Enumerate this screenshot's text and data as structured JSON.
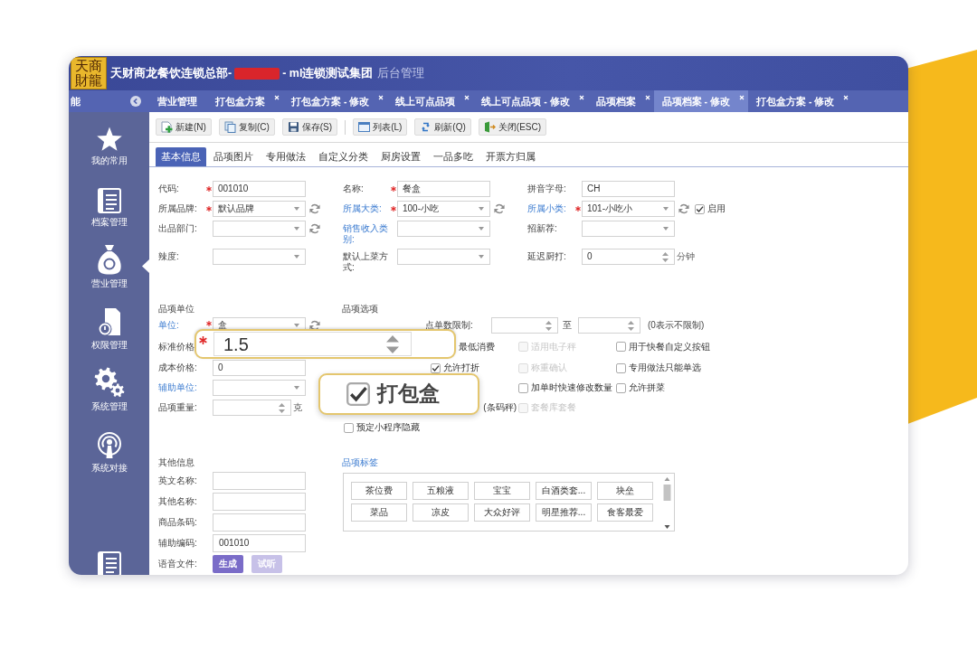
{
  "header": {
    "logo": "天商財龍",
    "title_parts": [
      {
        "kind": "text",
        "text": "天财商龙餐饮连锁总部-"
      },
      {
        "kind": "redacted"
      },
      {
        "kind": "text",
        "text": "- ml连锁测试集团"
      },
      {
        "kind": "muted",
        "text": "后台管理"
      }
    ]
  },
  "tab_bar": {
    "menu_label": "能",
    "tabs": [
      {
        "label": "营业管理",
        "closable": false,
        "selected": false
      },
      {
        "label": "打包盒方案",
        "closable": true,
        "selected": false
      },
      {
        "label": "打包盒方案 - 修改",
        "closable": true,
        "selected": false
      },
      {
        "label": "线上可点品项",
        "closable": true,
        "selected": false
      },
      {
        "label": "线上可点品项 - 修改",
        "closable": true,
        "selected": false
      },
      {
        "label": "品项档案",
        "closable": true,
        "selected": false
      },
      {
        "label": "品项档案 - 修改",
        "closable": true,
        "selected": true
      },
      {
        "label": "打包盒方案 - 修改",
        "closable": true,
        "selected": false
      }
    ]
  },
  "sidebar": {
    "items": [
      {
        "kind": "star",
        "label": "我的常用",
        "selected": false
      },
      {
        "kind": "archive",
        "label": "档案管理",
        "selected": false
      },
      {
        "kind": "bag",
        "label": "营业管理",
        "selected": true
      },
      {
        "kind": "document",
        "label": "权限管理",
        "selected": false
      },
      {
        "kind": "gears",
        "label": "系统管理",
        "selected": false
      },
      {
        "kind": "broadcast",
        "label": "系统对接",
        "selected": false
      },
      {
        "kind": "archive",
        "selected": false
      }
    ]
  },
  "toolbar": {
    "buttons": [
      {
        "kind": "new",
        "label": "新建(N)",
        "separator_before": false
      },
      {
        "kind": "copy",
        "label": "复制(C)",
        "separator_before": false
      },
      {
        "kind": "save",
        "label": "保存(S)",
        "separator_before": false
      },
      {
        "kind": "list",
        "label": "列表(L)",
        "separator_before": true
      },
      {
        "kind": "refresh",
        "label": "刷新(Q)",
        "separator_before": false
      },
      {
        "kind": "close",
        "label": "关闭(ESC)",
        "separator_before": false
      }
    ]
  },
  "form_tabs": [
    {
      "label": "基本信息",
      "selected": true
    },
    {
      "label": "品项图片",
      "selected": false
    },
    {
      "label": "专用做法",
      "selected": false
    },
    {
      "label": "自定义分类",
      "selected": false
    },
    {
      "label": "厨房设置",
      "selected": false
    },
    {
      "label": "一品多吃",
      "selected": false
    },
    {
      "label": "开票方归属",
      "selected": false
    }
  ],
  "basic_info": {
    "rows": [
      [
        {
          "label": "代码:",
          "link": false,
          "required": true,
          "kind": "text",
          "value": "001010",
          "refresh": false
        },
        {
          "label": "名称:",
          "link": false,
          "required": true,
          "kind": "text",
          "value": "餐盒",
          "refresh": false
        },
        {
          "label": "拼音字母:",
          "link": false,
          "required": false,
          "kind": "text",
          "value": "CH",
          "refresh": false
        }
      ],
      [
        {
          "label": "所属品牌:",
          "link": false,
          "required": true,
          "kind": "select",
          "value": "默认品牌",
          "refresh": true
        },
        {
          "label": "所属大类:",
          "link": true,
          "required": true,
          "kind": "select",
          "value": "100-小吃",
          "refresh": true
        },
        {
          "label": "所属小类:",
          "link": true,
          "required": true,
          "kind": "select",
          "value": "101-小吃小",
          "refresh": true,
          "toggle": {
            "label": "启用",
            "checked": true
          }
        }
      ],
      [
        {
          "label": "出品部门:",
          "link": false,
          "required": false,
          "kind": "select",
          "refresh": true
        },
        {
          "label": "销售收入类别:",
          "link": true,
          "required": false,
          "kind": "select",
          "refresh": false
        },
        {
          "label": "招新荐:",
          "link": false,
          "required": false,
          "kind": "select",
          "refresh": false
        }
      ],
      [
        {
          "label": "辣度:",
          "link": false,
          "required": false,
          "kind": "select",
          "refresh": false
        },
        {
          "label": "默认上菜方式:",
          "link": false,
          "required": false,
          "kind": "select",
          "refresh": false
        },
        {
          "label": "延迟厨打:",
          "link": false,
          "required": false,
          "kind": "number",
          "value": "0",
          "unit": "分钟",
          "refresh": false
        }
      ]
    ]
  },
  "unit_section": {
    "title": "品项单位",
    "fields": [
      {
        "label": "单位:",
        "link": true,
        "required": true,
        "kind": "select",
        "value": "盒",
        "refresh": true
      },
      {
        "label": "标准价格",
        "link": false,
        "required": false,
        "kind": "covered",
        "refresh": false
      },
      {
        "label": "成本价格:",
        "link": false,
        "required": false,
        "kind": "text",
        "value": "0",
        "refresh": false
      },
      {
        "label": "辅助单位:",
        "link": true,
        "required": false,
        "kind": "select",
        "refresh": false
      },
      {
        "label": "品项重量:",
        "link": false,
        "required": false,
        "kind": "number",
        "unit": "克",
        "refresh": false
      }
    ]
  },
  "options": {
    "title": "品项选项",
    "limit": {
      "label": "点单数限制:",
      "separator": "至",
      "note": "(0表示不限制)"
    },
    "rows": [
      [
        null,
        {
          "kind": "text",
          "text": "最低消费"
        },
        {
          "kind": "checkbox",
          "label": "适用电子秤",
          "checked": false,
          "disabled": true
        },
        {
          "kind": "checkbox",
          "label": "用于快餐自定义按钮",
          "checked": false,
          "disabled": false
        }
      ],
      [
        null,
        {
          "kind": "checkbox",
          "label": "允许打折",
          "checked": true,
          "disabled": false
        },
        {
          "kind": "checkbox",
          "label": "称重确认",
          "checked": false,
          "disabled": true
        },
        {
          "kind": "checkbox",
          "label": "专用做法只能单选",
          "checked": false,
          "disabled": false
        }
      ],
      [
        null,
        null,
        {
          "kind": "checkbox",
          "label": "加单时快速修改数量",
          "checked": false,
          "disabled": false
        },
        {
          "kind": "checkbox",
          "label": "允许拼菜",
          "checked": false,
          "disabled": false
        }
      ],
      [
        null,
        {
          "kind": "tail",
          "text": "(条码秤)"
        },
        {
          "kind": "checkbox",
          "label": "套餐库套餐",
          "checked": false,
          "disabled": true
        },
        null
      ],
      [
        {
          "kind": "checkbox",
          "label": "预定小程序隐藏",
          "checked": false,
          "disabled": false
        },
        null,
        null,
        null
      ]
    ]
  },
  "callouts": [
    {
      "kind": "number",
      "required": true,
      "value": "1.5"
    },
    {
      "kind": "checkbox",
      "label": "打包盒",
      "checked": true
    }
  ],
  "other_info": {
    "title": "其他信息",
    "fields": [
      {
        "label": "英文名称:"
      },
      {
        "label": "其他名称:"
      },
      {
        "label": "商品条码:"
      },
      {
        "label": "辅助编码:",
        "value": "001010"
      }
    ],
    "voice": {
      "label": "语音文件:",
      "buttons": [
        {
          "label": "生成",
          "disabled": false
        },
        {
          "label": "试听",
          "disabled": true
        }
      ]
    }
  },
  "tags": {
    "title": "品项标签",
    "items": [
      "茶位费",
      "五粮液",
      "宝宝",
      "白酒类套...",
      "块垒",
      "菜品",
      "凉皮",
      "大众好评",
      "明星推荐...",
      "食客最爱"
    ]
  }
}
